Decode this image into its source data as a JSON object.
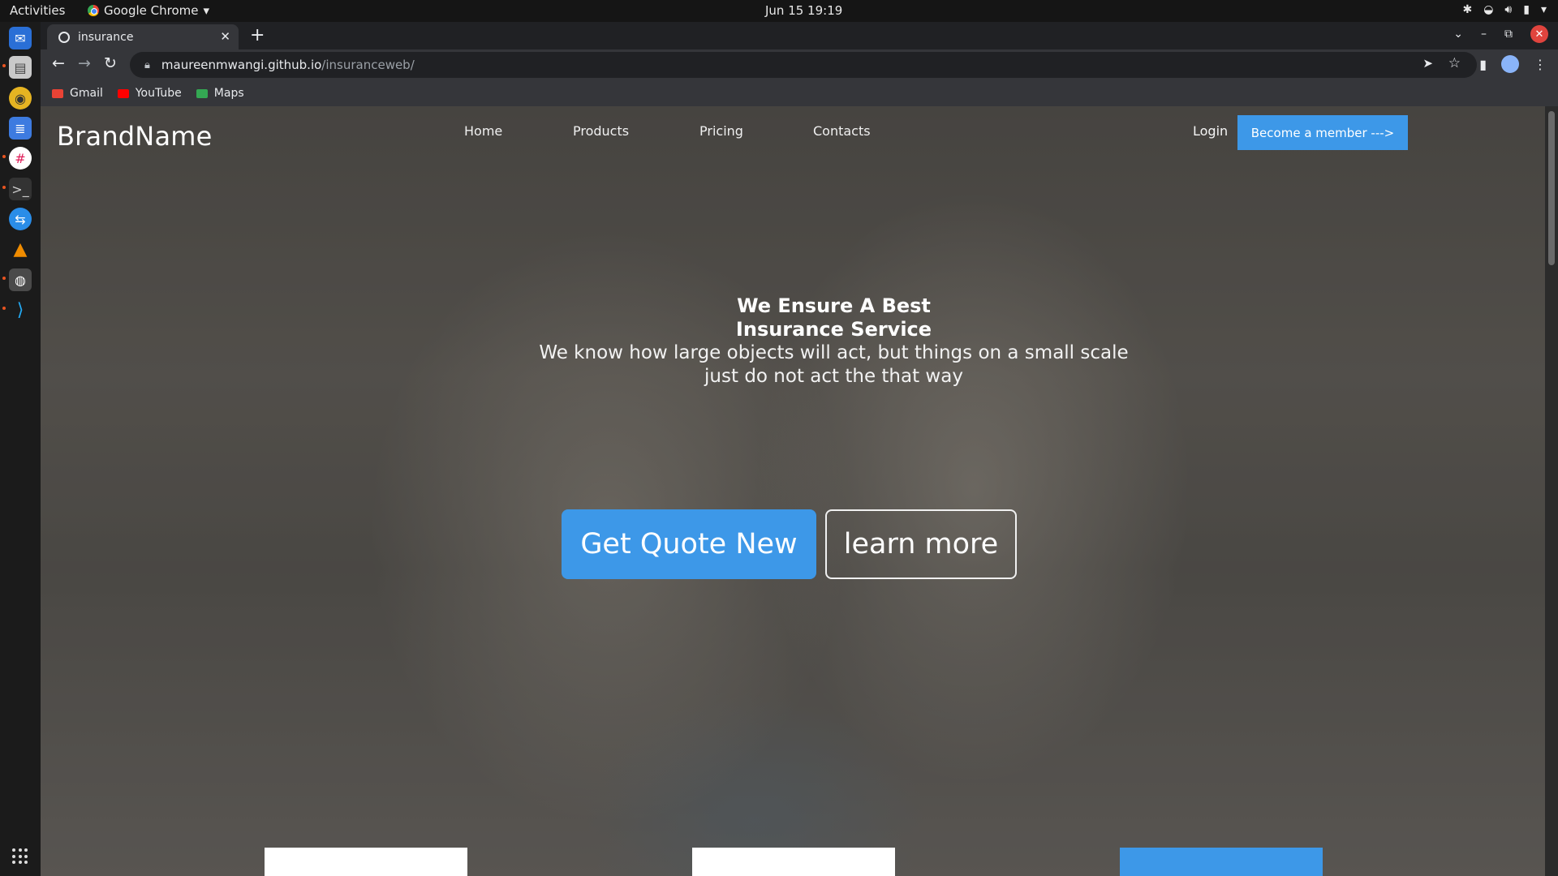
{
  "desktop": {
    "activities": "Activities",
    "app_name": "Google Chrome",
    "clock": "Jun 15  19:19"
  },
  "browser": {
    "tab_title": "insurance",
    "url_host": "maureenmwangi.github.io",
    "url_path": "/insuranceweb/",
    "bookmarks": [
      {
        "label": "Gmail",
        "color": "#ea4335"
      },
      {
        "label": "YouTube",
        "color": "#ff0000"
      },
      {
        "label": "Maps",
        "color": "#34a853"
      }
    ]
  },
  "site": {
    "brand": "BrandName",
    "nav": [
      "Home",
      "Products",
      "Pricing",
      "Contacts"
    ],
    "login": "Login",
    "member_button": "Become a member --->",
    "hero_title_line1": "We Ensure A Best",
    "hero_title_line2": "Insurance Service",
    "hero_subtitle": "We know how large objects will act, but things on a small scale just do not act the that way",
    "quote_button": "Get Quote New",
    "learn_button": "learn more",
    "accent_color": "#3d98e8",
    "cards": [
      {
        "value": "",
        "style": "white"
      },
      {
        "value": "",
        "style": "white"
      },
      {
        "value": "",
        "style": "blue"
      }
    ]
  }
}
